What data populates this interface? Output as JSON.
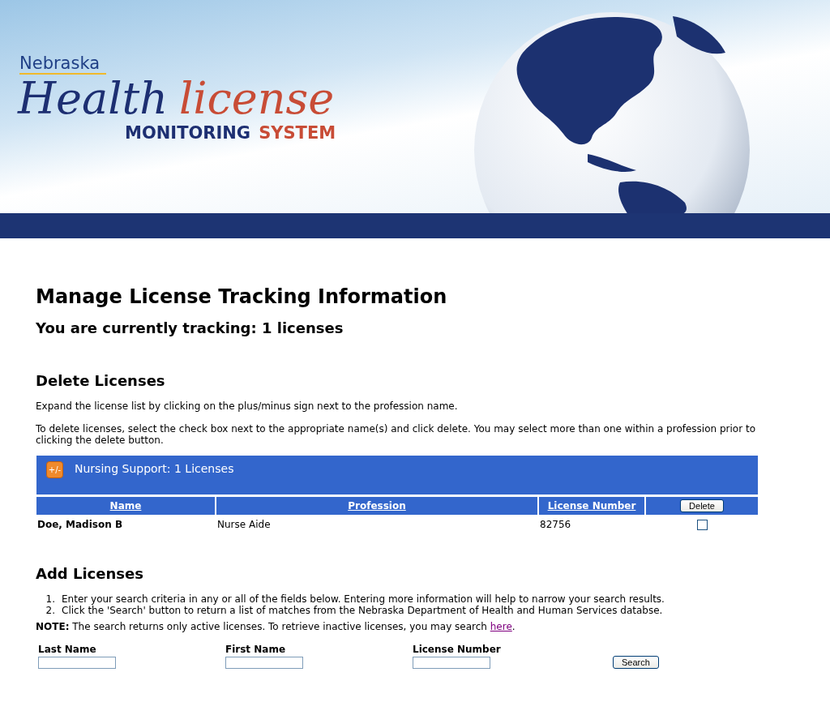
{
  "banner": {
    "state_name": "Nebraska",
    "title_part_1": "Health",
    "title_part_2": "license",
    "subtitle_part_1": "MONITORING",
    "subtitle_part_2": "SYSTEM"
  },
  "heading": "Manage License Tracking Information",
  "tracking": "You are currently tracking: 1 licenses",
  "delete_section": {
    "title": "Delete Licenses",
    "instructions": [
      "Expand the license list by clicking on the plus/minus sign next to the profession name.",
      "To delete licenses, select the check box next to the appropriate name(s) and click delete. You may select more than one within a profession prior to clicking the delete button."
    ],
    "groups": [
      {
        "toggle": "+/-",
        "title": "Nursing Support: 1 Licenses",
        "expanded": true,
        "columns": [
          "Name",
          "Profession",
          "License Number"
        ],
        "delete_button": "Delete",
        "rows": [
          {
            "name": "Doe, Madison B",
            "profession": "Nurse Aide",
            "license_number": "82756",
            "checked": false
          }
        ]
      }
    ]
  },
  "add_section": {
    "title": "Add Licenses",
    "steps": [
      {
        "number": "1.",
        "text": "Enter your search criteria in any or all of the fields below. Entering more information will help to narrow your search results."
      },
      {
        "number": "2.",
        "text": "Click the 'Search' button to return a list of matches from the Nebraska Department of Health and Human Services databse."
      }
    ],
    "note": {
      "text": "**NOTE:** The search returns only active licenses. To retrieve inactive licenses, you may search ",
      "link": "here",
      "end": "."
    },
    "fields": [
      {
        "label": "Last Name"
      },
      {
        "label": "First Name"
      },
      {
        "label": "License Number"
      }
    ],
    "search_button": "Search"
  }
}
